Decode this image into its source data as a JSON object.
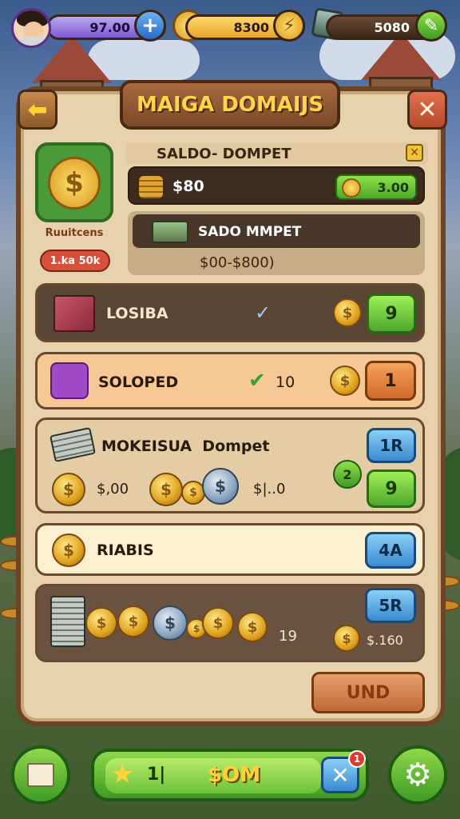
{
  "hud": {
    "profile_value": "97.00",
    "coins_value": "8300",
    "gems_value": "5080",
    "add_symbol": "+"
  },
  "window": {
    "title": "MAIGA DOMAIJS",
    "back_symbol": "⬅",
    "close_symbol": "✕"
  },
  "wallet_card": {
    "caption": "Ruuitcens",
    "badge": "1.ka 50k"
  },
  "saldo": {
    "header": "SALDO- DOMPET",
    "header_close": "✕",
    "balance": "$80",
    "balance_pill": "3.00",
    "sub_label": "SADO MMPET",
    "range": "$00-$800)"
  },
  "rows": [
    {
      "label": "LOSIBA",
      "check": "✓",
      "button": "9"
    },
    {
      "label": "SOLOPED",
      "count": "10",
      "button": "1"
    },
    {
      "label": "MOKEISUA  Dompet",
      "amount_a": "$,00",
      "amount_b": "$|..0",
      "small_badge": "2",
      "button_top": "1R",
      "button_bottom": "9"
    },
    {
      "label": "RIABIS",
      "button": "4A"
    },
    {
      "count": "19",
      "price": "$.160",
      "button": "5R"
    }
  ],
  "footer_button": "UND",
  "bottom_bar": {
    "stars": "1|",
    "label": "$OM",
    "notif_count": "1"
  },
  "colors": {
    "panel": "#e8d2ad",
    "title_text": "#ffd34a",
    "green_button": "#4ea82a",
    "blue_button": "#3a8ad0",
    "orange_button": "#d06a2a"
  }
}
